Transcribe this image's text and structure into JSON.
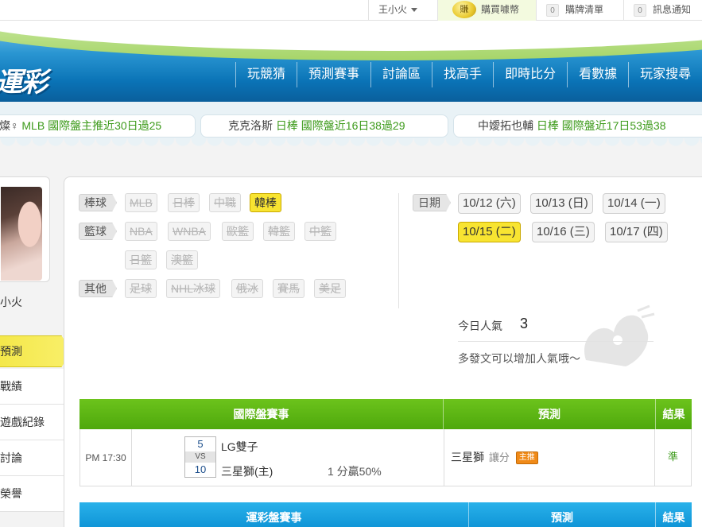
{
  "topbar": {
    "user_name": "王小火",
    "buy_label": "購買噱幣",
    "coin_label": "賺",
    "cart_count": "0",
    "cart_label": "購牌清單",
    "msg_count": "0",
    "msg_label": "訊息通知"
  },
  "header": {
    "logo_text": "運彩",
    "nav": [
      "玩競猜",
      "預測賽事",
      "討論區",
      "找高手",
      "即時比分",
      "看數據",
      "玩家搜尋"
    ]
  },
  "ticker": [
    {
      "prefix": "燦♀",
      "text": "MLB 國際盤主推近30日過25"
    },
    {
      "prefix": "克克洛斯",
      "text": "日棒 國際盤近16日38過29"
    },
    {
      "prefix": "中嬡拓也輔",
      "text": "日棒 國際盤近17日53過38"
    }
  ],
  "sidebar": {
    "profile_name": "小火",
    "active_item": "預測",
    "items": [
      "戰績",
      "遊戲紀錄",
      "討論",
      "榮譽"
    ]
  },
  "categories": {
    "baseball": {
      "label": "棒球",
      "leagues": [
        "MLB",
        "日棒",
        "中職",
        "韓棒"
      ]
    },
    "basketball": {
      "label": "籃球",
      "leagues": [
        "NBA",
        "WNBA",
        "歐籃",
        "韓籃",
        "中籃",
        "日籃",
        "澳籃"
      ]
    },
    "other": {
      "label": "其他",
      "leagues": [
        "足球",
        "NHL冰球",
        "俄冰",
        "賽馬",
        "美足"
      ]
    },
    "active_league": "韓棒"
  },
  "dates": {
    "label": "日期",
    "items": [
      "10/12 (六)",
      "10/13 (日)",
      "10/14 (一)",
      "10/15 (二)",
      "10/16 (三)",
      "10/17 (四)"
    ],
    "active": "10/15 (二)"
  },
  "popularity": {
    "label": "今日人氣",
    "value": "3",
    "tip": "多發文可以增加人氣哦～"
  },
  "intl_table": {
    "headers": [
      "國際盤賽事",
      "預測",
      "結果"
    ],
    "rows": [
      {
        "time": "PM 17:30",
        "away_score": "5",
        "vs": "VS",
        "home_score": "10",
        "away_team": "LG雙子",
        "home_team": "三星獅(主)",
        "odds": "1 分贏50%",
        "pick": "三星獅",
        "pick_type": "讓分",
        "badge": "主推",
        "result": "準"
      }
    ]
  },
  "sports_table": {
    "headers": [
      "運彩盤賽事",
      "預測",
      "結果"
    ]
  }
}
